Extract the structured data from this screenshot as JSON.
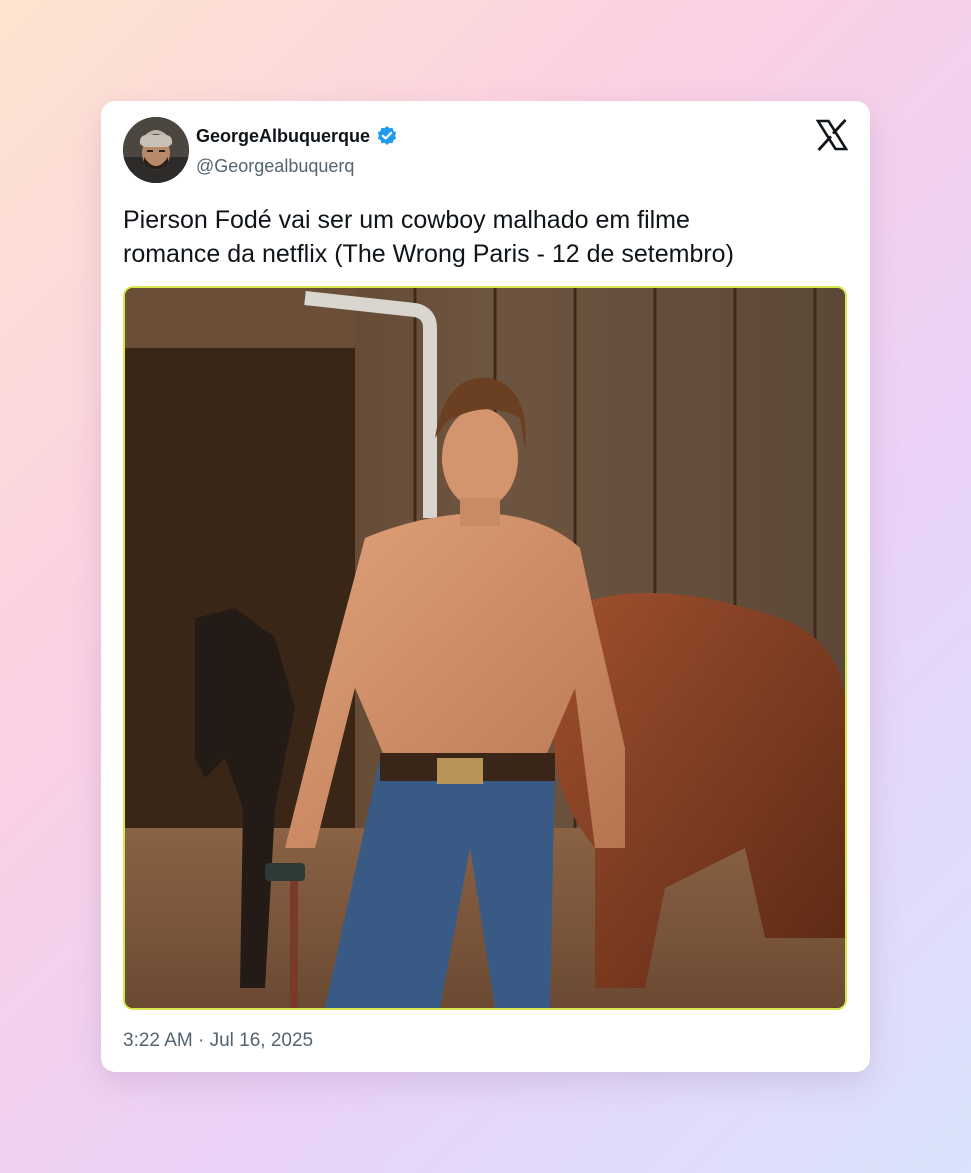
{
  "tweet": {
    "display_name": "GeorgeAlbuquerque",
    "handle": "@Georgealbuquerq",
    "verified": true,
    "text": "Pierson Fodé  vai ser um cowboy malhado em filme\nromance da netflix (The Wrong Paris - 12 de setembro)",
    "timestamp": "3:22 AM · Jul 16, 2025"
  },
  "icons": {
    "avatar": "profile-photo",
    "verified": "verified-badge-icon",
    "brand": "x-logo-icon"
  },
  "media": {
    "description_icon": "photo",
    "highlight_border": "#d8e84a"
  },
  "colors": {
    "card_bg": "#ffffff",
    "text_primary": "#0f1419",
    "text_secondary": "#536471",
    "verified_blue": "#1d9bf0"
  }
}
